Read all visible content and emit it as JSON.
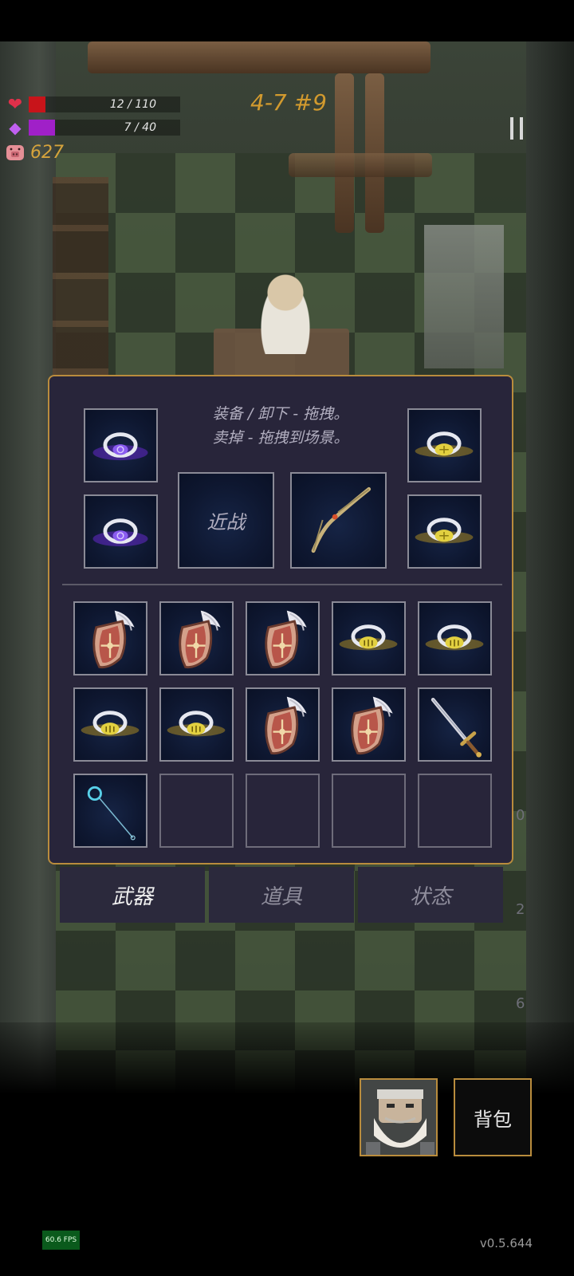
{
  "hud": {
    "health_text": "12 / 110",
    "health_fraction": 0.109,
    "health_color": "#c8141a",
    "mana_text": "7 / 40",
    "mana_fraction": 0.175,
    "mana_color": "#a020c8",
    "gold": "627",
    "level": "4-7 #9"
  },
  "inventory": {
    "instructions_line1": "装备 / 卸下 - 拖拽。",
    "instructions_line2": "卖掉 - 拖拽到场景。",
    "melee_label": "近战",
    "equipped": {
      "left_top": "purple-ring-icon",
      "left_bottom": "purple-ring-icon",
      "weapon": "bow-icon",
      "right_top": "gold-ring-icon",
      "right_bottom": "gold-ring-icon"
    },
    "grid": [
      "winged-shield-icon",
      "winged-shield-icon",
      "winged-shield-icon",
      "gold-ring-icon",
      "gold-ring-icon",
      "gold-ring-icon",
      "gold-ring-icon",
      "winged-shield-icon",
      "winged-shield-icon",
      "sword-icon",
      "staff-icon",
      "",
      "",
      "",
      ""
    ]
  },
  "tabs": {
    "weapons": "武器",
    "items": "道具",
    "status": "状态"
  },
  "side_numbers": [
    "0",
    "2",
    "6"
  ],
  "bottom": {
    "bag_label": "背包"
  },
  "fps": "60.6 FPS",
  "version": "v0.5.644",
  "colors": {
    "panel_border": "#b98c3d",
    "level_text": "#d29a2e",
    "gold_text": "#d6a33c"
  }
}
